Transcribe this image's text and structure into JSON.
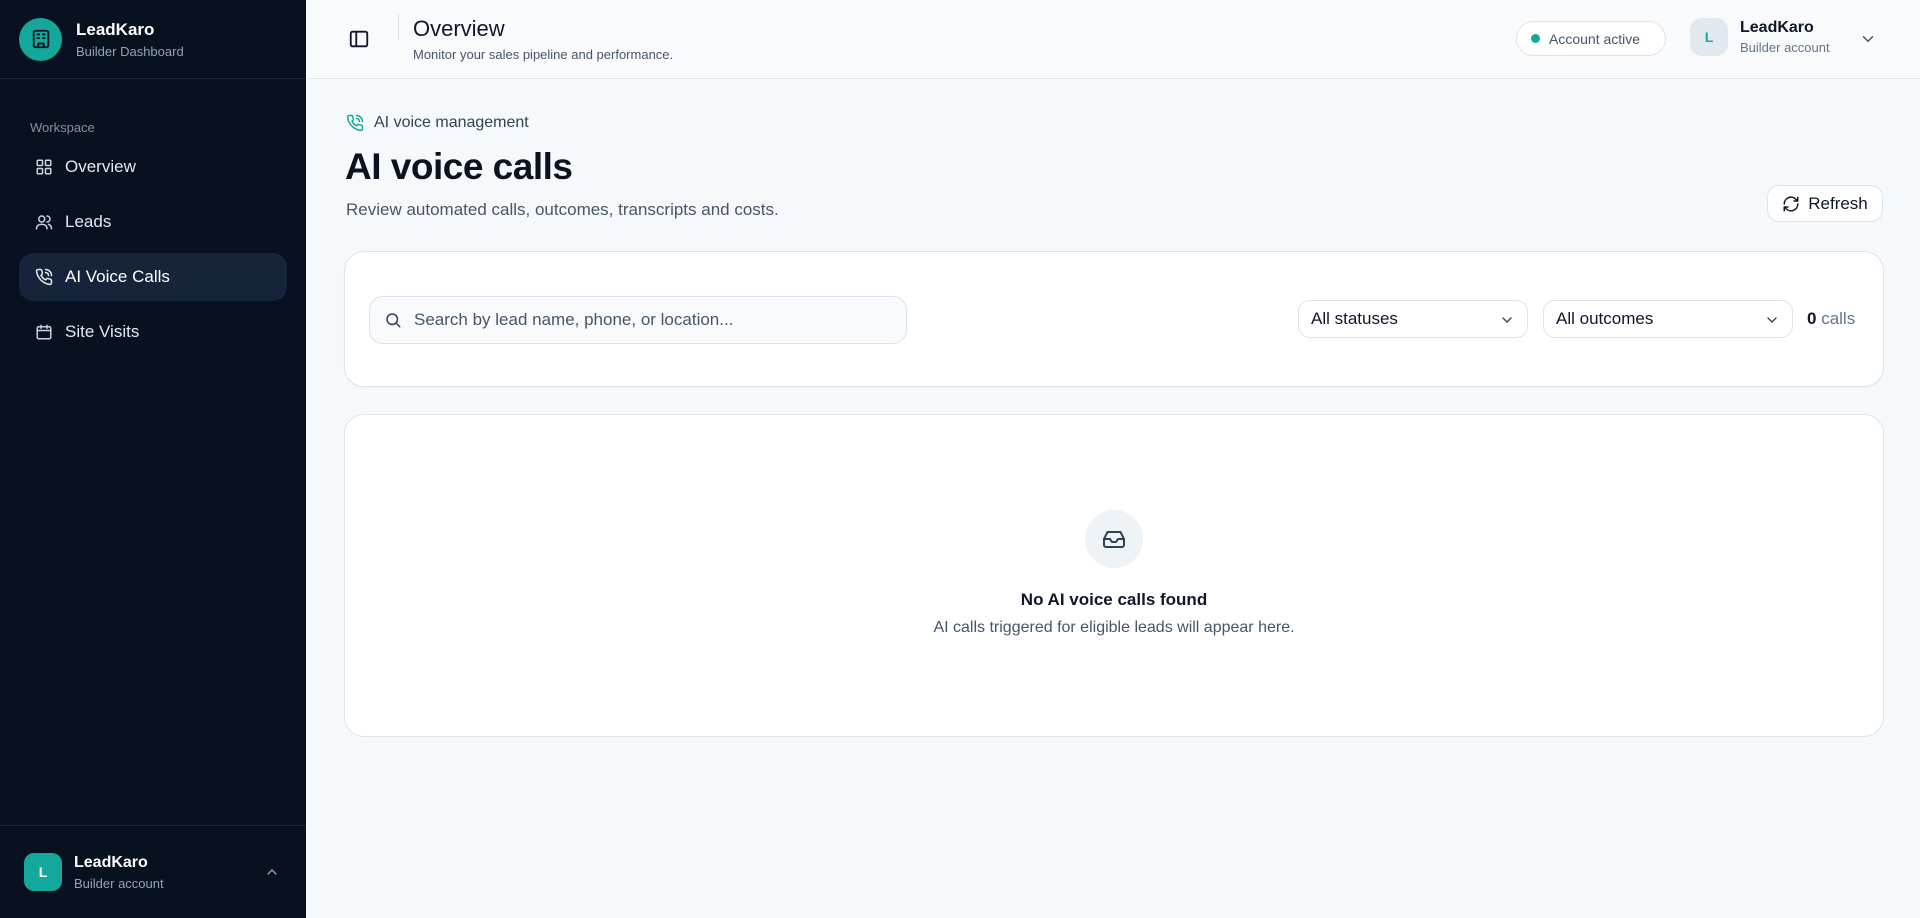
{
  "brand": {
    "name": "LeadKaro",
    "subtitle": "Builder Dashboard"
  },
  "sidebar": {
    "section_label": "Workspace",
    "items": [
      {
        "label": "Overview",
        "icon": "grid-icon",
        "active": false
      },
      {
        "label": "Leads",
        "icon": "users-icon",
        "active": false
      },
      {
        "label": "AI Voice Calls",
        "icon": "phone-call-icon",
        "active": true
      },
      {
        "label": "Site Visits",
        "icon": "calendar-icon",
        "active": false
      }
    ],
    "footer": {
      "avatar_initial": "L",
      "name": "LeadKaro",
      "role": "Builder account"
    }
  },
  "header": {
    "title": "Overview",
    "subtitle": "Monitor your sales pipeline and performance.",
    "status": "Account active",
    "account": {
      "avatar_initial": "L",
      "name": "LeadKaro",
      "role": "Builder account"
    }
  },
  "main": {
    "breadcrumb": "AI voice management",
    "title": "AI voice calls",
    "subtitle": "Review automated calls, outcomes, transcripts and costs.",
    "refresh_label": "Refresh",
    "filters": {
      "search_placeholder": "Search by lead name, phone, or location...",
      "status_select": "All statuses",
      "outcome_select": "All outcomes",
      "count": "0",
      "count_unit": "calls"
    },
    "empty": {
      "title": "No AI voice calls found",
      "subtitle": "AI calls triggered for eligible leads will appear here."
    }
  },
  "colors": {
    "accent": "#14a89c",
    "sidebar_bg": "#07111f",
    "active_item_bg": "#15243a"
  }
}
